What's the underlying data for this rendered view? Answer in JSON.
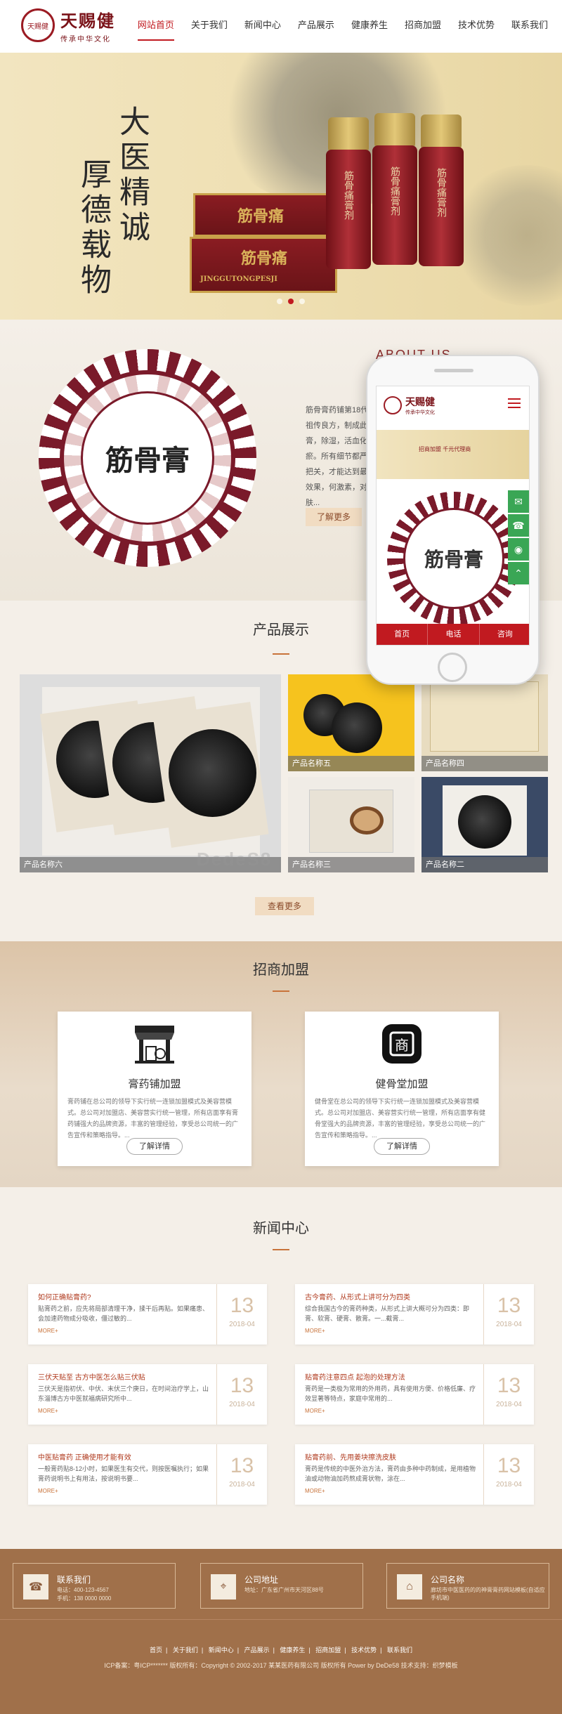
{
  "header": {
    "logo_main": "天赐健",
    "logo_sub": "传承中华文化",
    "logo_seal": "天赐健",
    "nav": [
      "网站首页",
      "关于我们",
      "新闻中心",
      "产品展示",
      "健康养生",
      "招商加盟",
      "技术优势",
      "联系我们"
    ],
    "active_nav": "网站首页"
  },
  "banner": {
    "slogan_right": "大医精诚",
    "slogan_left": "厚德载物",
    "box_text": "筋骨痛",
    "box_sub": "JINGGUTONGPESJI",
    "bottle_text": "筋骨痛膏剂",
    "dots": 3,
    "active_dot": 1
  },
  "about": {
    "title": "ABOUT US",
    "text": "筋骨膏药铺第18代祖传良方，制成此膏，除湿，活血化瘀。所有细节都严格把关，才能达到最好效果，何激素，对皮肤...",
    "seal_text": "筋骨膏",
    "button": "了解更多"
  },
  "phone": {
    "logo": "天赐健",
    "logo_sub": "传承中华文化",
    "banner_text": "招商加盟 千元代理商",
    "seal_text": "筋骨膏",
    "side_icons": [
      "chat-icon",
      "phone-icon",
      "wechat-icon",
      "top-icon"
    ],
    "tabs": [
      "首页",
      "电话",
      "咨询"
    ]
  },
  "products": {
    "title": "产品展示",
    "items": [
      "产品名称六",
      "产品名称五",
      "产品名称四",
      "产品名称三",
      "产品名称二"
    ],
    "more": "查看更多",
    "watermark": "DedeS8"
  },
  "franchise": {
    "title": "招商加盟",
    "cards": [
      {
        "icon": "storefront-icon",
        "title": "膏药铺加盟",
        "text": "膏药铺在总公司的领导下实行统一连锁加盟模式及美容营模式。总公司对加盟店、美容营实行统一管理，所有店面享有膏药铺强大的品牌资源，丰富的管理经验，享受总公司统一的广告宣传和策略指导。...",
        "button": "了解详情"
      },
      {
        "icon": "shop-seal-icon",
        "title": "健骨堂加盟",
        "text": "健骨堂在总公司的领导下实行统一连锁加盟模式及美容营模式。总公司对加盟店、美容营实行统一管理，所有店面享有健骨堂强大的品牌资源，丰富的管理经验，享受总公司统一的广告宣传和策略指导。...",
        "button": "了解详情"
      }
    ]
  },
  "news": {
    "title": "新闻中心",
    "items": [
      {
        "title": "如何正确贴膏药?",
        "desc": "贴膏药之前，应先将局部清理干净，揉干后再贴。如果痛患、会加速药物成分吸收，僵过敏的...",
        "more": "MORE+",
        "day": "13",
        "month": "2018-04"
      },
      {
        "title": "古今膏药、从形式上讲可分为四类",
        "desc": "综合我国古今的膏药种类，从形式上讲大概可分为四类：即膏、软膏、硬膏、散膏。一...截膏...",
        "more": "MORE+",
        "day": "13",
        "month": "2018-04"
      },
      {
        "title": "三伏天贴至 古方中医怎么贴三伏贴",
        "desc": "三伏天是指初伏、中伏、末伏三个庚日，在时间治疗学上，山东淄博古方中医就福病研究所中...",
        "more": "MORE+",
        "day": "13",
        "month": "2018-04"
      },
      {
        "title": "贴膏药注意四点 起泡的处理方法",
        "desc": "膏药是一类极为常用的外用药，具有使用方便、价格低廉、疗效显著等特点，家庭中常用的...",
        "more": "MORE+",
        "day": "13",
        "month": "2018-04"
      },
      {
        "title": "中医贴膏药 正确使用才能有效",
        "desc": "一般膏药贴8-12小时，如果医生有交代，则按医嘱执行；如果膏药说明书上有用法，按说明书要...",
        "more": "MORE+",
        "day": "13",
        "month": "2018-04"
      },
      {
        "title": "贴膏药前、先用姜块擦洗皮肤",
        "desc": "膏药是传统的中医外治方法，膏药由多种中药制成，是用植物油或动物油加药熬成膏状物，涂在...",
        "more": "MORE+",
        "day": "13",
        "month": "2018-04"
      }
    ]
  },
  "contact": [
    {
      "icon": "phone-icon",
      "title": "联系我们",
      "lines": [
        "电话：400-123-4567",
        "手机：138 0000 0000"
      ]
    },
    {
      "icon": "location-icon",
      "title": "公司地址",
      "lines": [
        "地址：广东省广州市天河区88号"
      ]
    },
    {
      "icon": "home-icon",
      "title": "公司名称",
      "lines": [
        "廊坊市中医医药的的神膏膏药网站模板(自适应手机端)"
      ]
    }
  ],
  "footer": {
    "links": [
      "首页",
      "关于我们",
      "新闻中心",
      "产品展示",
      "健康养生",
      "招商加盟",
      "技术优势",
      "联系我们"
    ],
    "copyright": "ICP备案：粤ICP******* 版权所有：Copyright © 2002-2017 某某医药有限公司 版权所有 Power by DeDe58 技术支持：织梦模板"
  }
}
